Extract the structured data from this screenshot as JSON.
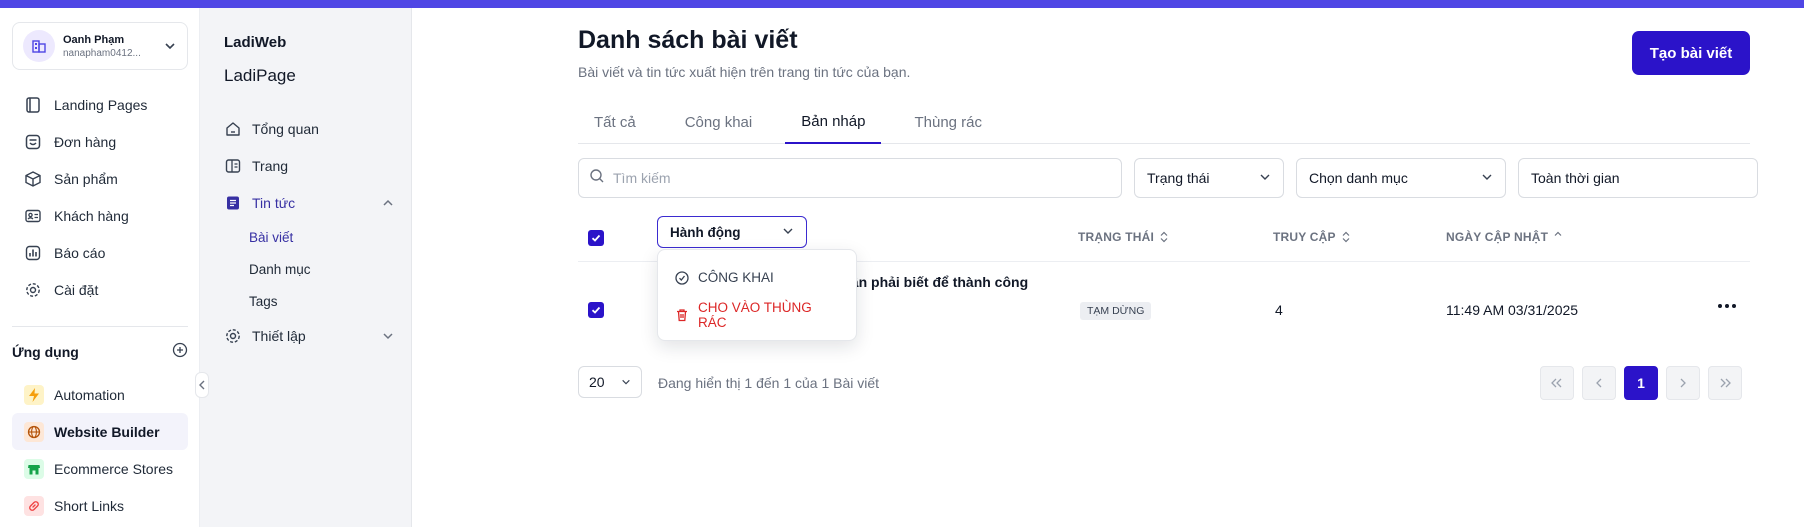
{
  "user": {
    "name": "Oanh Phạm",
    "email": "nanapham0412..."
  },
  "nav": [
    {
      "label": "Landing Pages",
      "icon": "landing-pages-icon"
    },
    {
      "label": "Đơn hàng",
      "icon": "orders-icon"
    },
    {
      "label": "Sản phẩm",
      "icon": "box-icon"
    },
    {
      "label": "Khách hàng",
      "icon": "customer-card-icon"
    },
    {
      "label": "Báo cáo",
      "icon": "report-chart-icon"
    },
    {
      "label": "Cài đặt",
      "icon": "gear-icon"
    }
  ],
  "apps": {
    "heading": "Ứng dụng",
    "items": [
      {
        "label": "Automation",
        "icon": "lightning-icon",
        "color": "#f59e0b"
      },
      {
        "label": "Website Builder",
        "icon": "globe-icon",
        "color": "#b45309"
      },
      {
        "label": "Ecommerce Stores",
        "icon": "store-icon",
        "color": "#16a34a"
      },
      {
        "label": "Short Links",
        "icon": "link-icon",
        "color": "#ef4444"
      }
    ]
  },
  "sidebar2": {
    "title": "LadiWeb",
    "subtitle": "LadiPage",
    "items": {
      "overview": "Tổng quan",
      "pages": "Trang",
      "news": "Tin tức",
      "posts": "Bài viết",
      "categories": "Danh mục",
      "tags": "Tags",
      "setup": "Thiết lập"
    }
  },
  "header": {
    "title": "Danh sách bài viết",
    "subtitle": "Bài viết và tin tức xuất hiện trên trang tin tức của bạn.",
    "create_button": "Tạo bài viết"
  },
  "tabs": [
    "Tất cả",
    "Công khai",
    "Bản nháp",
    "Thùng rác"
  ],
  "active_tab": "Bản nháp",
  "filters": {
    "search_placeholder": "Tìm kiếm",
    "status": "Trạng thái",
    "category": "Chọn danh mục",
    "time": "Toàn thời gian"
  },
  "table": {
    "action_label": "Hành động",
    "columns": {
      "status": "TRẠNG THÁI",
      "visits": "TRUY CẬP",
      "updated": "NGÀY CẬP NHẬT"
    },
    "rows": [
      {
        "title": "cần phải biết để thành công",
        "status": "TẠM DỪNG",
        "visits": "4",
        "updated": "11:49 AM 03/31/2025"
      }
    ]
  },
  "action_menu": {
    "publish": "CÔNG KHAI",
    "trash": "CHO VÀO THÙNG RÁC"
  },
  "footer": {
    "page_size": "20",
    "info": "Đang hiển thị 1 đến 1 của 1 Bài viết",
    "current_page": "1"
  },
  "colors": {
    "accent": "#2b13c9",
    "danger": "#dc2626",
    "topbar": "#4f46e5"
  }
}
